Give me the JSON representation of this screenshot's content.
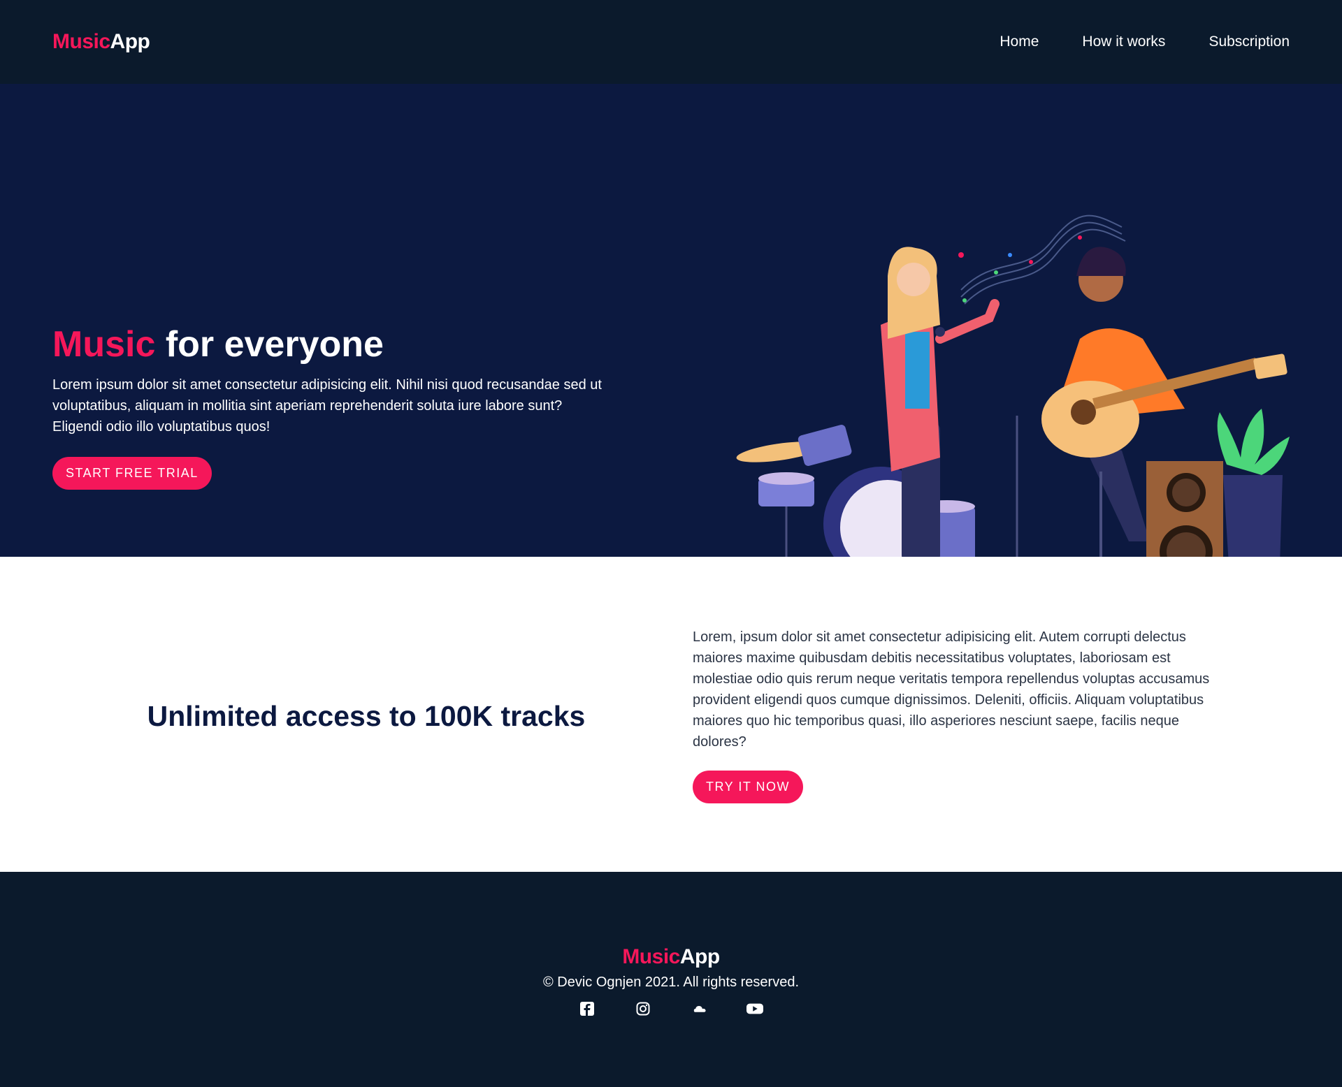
{
  "header": {
    "logo": {
      "accent": "Music",
      "rest": "App"
    },
    "nav": [
      {
        "label": "Home"
      },
      {
        "label": "How it works"
      },
      {
        "label": "Subscription"
      }
    ]
  },
  "hero": {
    "title_accent": "Music",
    "title_rest": " for everyone",
    "description": "Lorem ipsum dolor sit amet consectetur adipisicing elit. Nihil nisi quod recusandae sed ut voluptatibus, aliquam in mollitia sint aperiam reprehenderit soluta iure labore sunt? Eligendi odio illo voluptatibus quos!",
    "cta_label": "START FREE TRIAL"
  },
  "feature": {
    "title": "Unlimited access to 100K tracks",
    "description": "Lorem, ipsum dolor sit amet consectetur adipisicing elit. Autem corrupti delectus maiores maxime quibusdam debitis necessitatibus voluptates, laboriosam est molestiae odio quis rerum neque veritatis tempora repellendus voluptas accusamus provident eligendi quos cumque dignissimos. Deleniti, officiis. Aliquam voluptatibus maiores quo hic temporibus quasi, illo asperiores nesciunt saepe, facilis neque dolores?",
    "cta_label": "TRY IT NOW"
  },
  "footer": {
    "logo": {
      "accent": "Music",
      "rest": "App"
    },
    "copyright": "© Devic Ognjen 2021. All rights reserved.",
    "socials": [
      "facebook-icon",
      "instagram-icon",
      "soundcloud-icon",
      "youtube-icon"
    ]
  },
  "colors": {
    "accent": "#f5175a",
    "nav_bg": "#0b1a2c",
    "hero_bg": "#0c1940",
    "heading_dark": "#0c1940"
  }
}
